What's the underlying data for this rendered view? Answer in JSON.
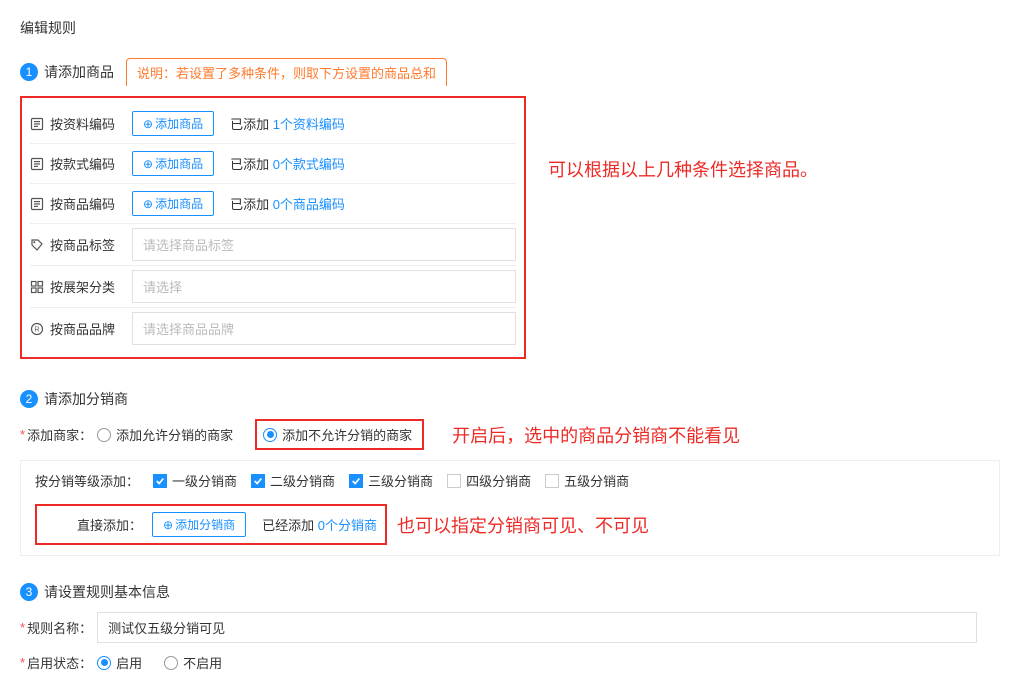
{
  "title": "编辑规则",
  "section1": {
    "badge": "1",
    "title": "请添加商品",
    "note": "说明：若设置了多种条件，则取下方设置的商品总和",
    "rows": [
      {
        "label": "按资料编码",
        "button": "添加商品",
        "added_left": "已添加 ",
        "added_link": "1个资料编码"
      },
      {
        "label": "按款式编码",
        "button": "添加商品",
        "added_left": "已添加 ",
        "added_link": "0个款式编码"
      },
      {
        "label": "按商品编码",
        "button": "添加商品",
        "added_left": "已添加 ",
        "added_link": "0个商品编码"
      }
    ],
    "selects": [
      {
        "label": "按商品标签",
        "placeholder": "请选择商品标签"
      },
      {
        "label": "按展架分类",
        "placeholder": "请选择"
      },
      {
        "label": "按商品品牌",
        "placeholder": "请选择商品品牌"
      }
    ],
    "annotation": "可以根据以上几种条件选择商品。"
  },
  "section2": {
    "badge": "2",
    "title": "请添加分销商",
    "merchant_label": "添加商家：",
    "radio1": "添加允许分销的商家",
    "radio2": "添加不允许分销的商家",
    "annotation1": "开启后，选中的商品分销商不能看见",
    "level_label": "按分销等级添加：",
    "levels": [
      {
        "label": "一级分销商",
        "checked": true
      },
      {
        "label": "二级分销商",
        "checked": true
      },
      {
        "label": "三级分销商",
        "checked": true
      },
      {
        "label": "四级分销商",
        "checked": false
      },
      {
        "label": "五级分销商",
        "checked": false
      }
    ],
    "direct_label": "直接添加：",
    "direct_button": "添加分销商",
    "direct_added_left": "已经添加 ",
    "direct_added_link": "0个分销商",
    "annotation2": "也可以指定分销商可见、不可见"
  },
  "section3": {
    "badge": "3",
    "title": "请设置规则基本信息",
    "name_label": "规则名称：",
    "name_value": "测试仅五级分销可见",
    "status_label": "启用状态：",
    "status_on": "启用",
    "status_off": "不启用"
  }
}
